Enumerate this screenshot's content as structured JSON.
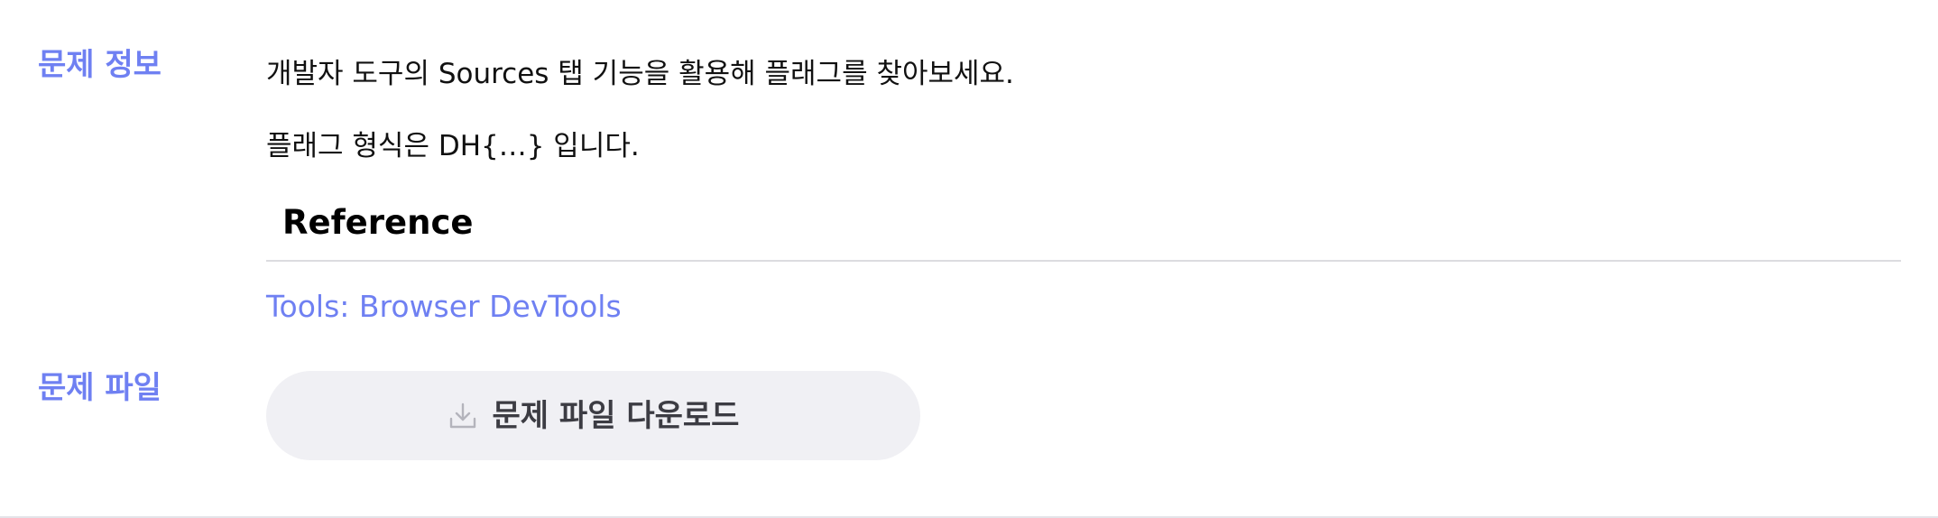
{
  "problem_info": {
    "label": "문제 정보",
    "paragraphs": [
      "개발자 도구의 Sources 탭 기능을 활용해 플래그를 찾아보세요.",
      "플래그 형식은 DH{…} 입니다."
    ],
    "reference": {
      "heading": "Reference",
      "link_text": "Tools: Browser DevTools"
    }
  },
  "problem_file": {
    "label": "문제 파일",
    "download_label": "문제 파일 다운로드",
    "download_icon": "download-icon"
  },
  "colors": {
    "accent": "#6f80f2",
    "button_bg": "#f0f0f4",
    "text": "#111111"
  }
}
